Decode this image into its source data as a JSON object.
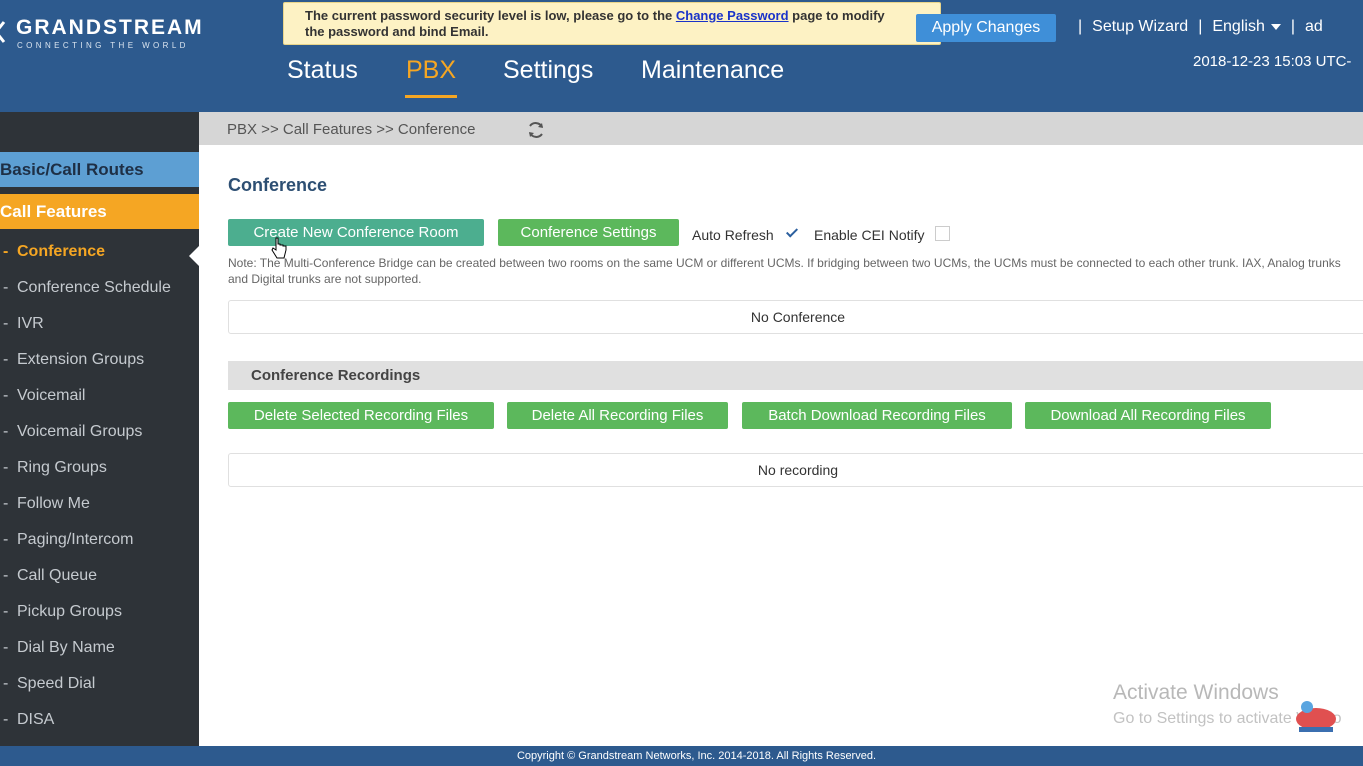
{
  "header": {
    "logo_main": "GRANDSTREAM",
    "logo_sub": "CONNECTING THE WORLD",
    "warning_prefix": "The current password security level is low, please go to the ",
    "warning_link": "Change Password",
    "warning_suffix": " page to modify",
    "warning_line2": "the password and bind Email.",
    "apply_changes": "Apply Changes",
    "setup_wizard": "Setup Wizard",
    "language": "English",
    "separator": "|",
    "user_truncated": "ad",
    "datetime": "2018-12-23 15:03 UTC-"
  },
  "nav": {
    "items": [
      {
        "label": "Status"
      },
      {
        "label": "PBX"
      },
      {
        "label": "Settings"
      },
      {
        "label": "Maintenance"
      }
    ]
  },
  "sidebar": {
    "section_basic": "Basic/Call Routes",
    "section_call_features": "Call Features",
    "dash": "-",
    "items": [
      {
        "label": "Conference"
      },
      {
        "label": "Conference Schedule"
      },
      {
        "label": "IVR"
      },
      {
        "label": "Extension Groups"
      },
      {
        "label": "Voicemail"
      },
      {
        "label": "Voicemail Groups"
      },
      {
        "label": "Ring Groups"
      },
      {
        "label": "Follow Me"
      },
      {
        "label": "Paging/Intercom"
      },
      {
        "label": "Call Queue"
      },
      {
        "label": "Pickup Groups"
      },
      {
        "label": "Dial By Name"
      },
      {
        "label": "Speed Dial"
      },
      {
        "label": "DISA"
      }
    ]
  },
  "breadcrumb": "PBX >> Call Features >> Conference",
  "main": {
    "title": "Conference",
    "create_button": "Create New Conference Room",
    "settings_button": "Conference Settings",
    "auto_refresh_label": "Auto Refresh",
    "auto_refresh_checked": true,
    "cei_notify_label": "Enable CEI Notify",
    "cei_notify_checked": false,
    "note": "Note: The Multi-Conference Bridge can be created between two rooms on the same UCM or different UCMs. If bridging between two UCMs, the UCMs must be connected to each other trunk. IAX, Analog trunks and Digital trunks are not supported.",
    "no_conference": "No Conference",
    "recordings_title": "Conference Recordings",
    "delete_selected": "Delete Selected Recording Files",
    "delete_all": "Delete All Recording Files",
    "batch_download": "Batch Download Recording Files",
    "download_all": "Download All Recording Files",
    "no_recording": "No recording"
  },
  "watermark": {
    "line1": "Activate Windows",
    "line2": "Go to Settings to activate Windo"
  },
  "footer": "Copyright © Grandstream Networks, Inc. 2014-2018. All Rights Reserved.",
  "colors": {
    "header_bg": "#2d5a8e",
    "accent_orange": "#f5a623",
    "button_green": "#5cb85c",
    "apply_blue": "#3f8fd8",
    "sidebar_bg": "#2e3338"
  }
}
